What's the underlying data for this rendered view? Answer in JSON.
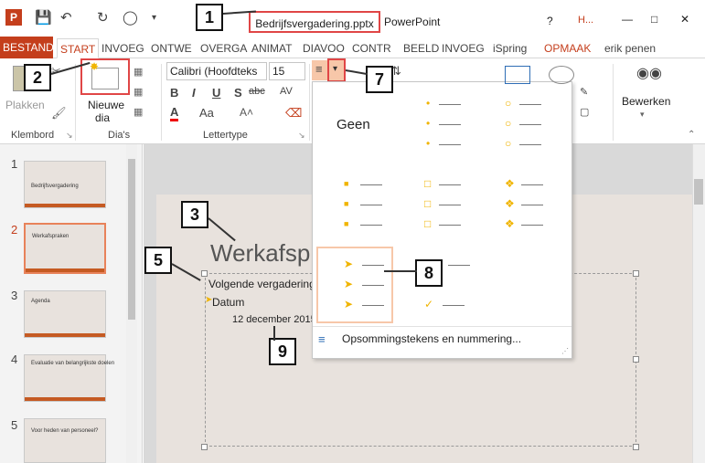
{
  "titlebar": {
    "file_name": "Bedrijfsvergadering.pptx",
    "app_name": "PowerPoint",
    "help": "?",
    "window_controls": [
      "—",
      "□",
      "✕"
    ],
    "lock_icon": "H..."
  },
  "tabs": {
    "file": "BESTAND",
    "items": [
      "START",
      "INVOEG",
      "ONTWE",
      "OVERGA",
      "ANIMAT",
      "DIAVOO",
      "CONTR",
      "BEELD",
      "INVOEG",
      "iSpring",
      "OPMAAK"
    ],
    "user": "erik penen"
  },
  "ribbon": {
    "clipboard": {
      "paste": "Plakken",
      "group": "Klembord"
    },
    "slides": {
      "new_slide_line1": "Nieuwe",
      "new_slide_line2": "dia",
      "group": "Dia's"
    },
    "font": {
      "name": "Calibri (Hoofdteks",
      "size": "15",
      "group": "Lettertype",
      "bold": "B",
      "italic": "I",
      "underline": "U",
      "shadow": "S",
      "strike": "abc",
      "spacing": "AV",
      "color_a": "A",
      "case": "Aa"
    },
    "edit": {
      "label": "Bewerken"
    }
  },
  "thumbnails": [
    {
      "num": "1",
      "title": "Bedrijfsvergadering"
    },
    {
      "num": "2",
      "title": "Werkafspraken"
    },
    {
      "num": "3",
      "title": "Agenda"
    },
    {
      "num": "4",
      "title": "Evaluatie van belangrijkste doelen"
    },
    {
      "num": "5",
      "title": "Voor heden van personeel?"
    }
  ],
  "slide": {
    "title": "Werkafspr",
    "line1": "Volgende vergadering",
    "line2": "Datum",
    "line3": "12 december 2015"
  },
  "bullet_menu": {
    "none_label": "Geen",
    "footer": "Opsommingstekens en nummering..."
  },
  "callouts": [
    "1",
    "2",
    "3",
    "5",
    "7",
    "8",
    "9"
  ],
  "colors": {
    "accent": "#c43e1c",
    "callout_border": "#e04646",
    "bullet": "#f0b400"
  }
}
